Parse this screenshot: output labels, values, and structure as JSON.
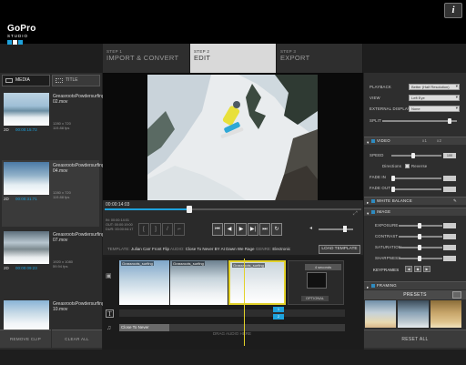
{
  "app": {
    "logo_word": "GoPro",
    "logo_sub": "STUDIO",
    "info_label": "i"
  },
  "steps": [
    {
      "step": "STEP 1",
      "label": "IMPORT & CONVERT"
    },
    {
      "step": "STEP 2",
      "label": "EDIT"
    },
    {
      "step": "STEP 3",
      "label": "EXPORT"
    }
  ],
  "left_tabs": [
    {
      "label": "MEDIA"
    },
    {
      "label": "TITLE"
    }
  ],
  "clips": [
    {
      "name": "GreasrootsPowdersurfing 02.mov",
      "resolution": "1280 x 720",
      "fps": "119.88 fps",
      "flags": "2D",
      "time": "00:00:15:72"
    },
    {
      "name": "GreasrootsPowdersurfing 04.mov",
      "resolution": "1280 x 720",
      "fps": "119.88 fps",
      "flags": "2D",
      "time": "00:00:31:71"
    },
    {
      "name": "GreasrootsPowdersurfing 07.mov",
      "resolution": "1920 x 1080",
      "fps": "59.94 fps",
      "flags": "2D",
      "time": "00:00:09:23"
    },
    {
      "name": "GreasrootsPowdersurfing 10.mov",
      "resolution": "1280 x 720",
      "fps": "119.88 fps",
      "flags": "2D",
      "time": "00:00:39:76"
    }
  ],
  "left_buttons": {
    "remove": "REMOVE CLIP",
    "clear": "CLEAR ALL"
  },
  "playback": {
    "timecode": "00:00:14:03",
    "in_out": [
      "IN: 00:00:14:01",
      "OUT: 00:00:19:00",
      "DUR: 00:00:04:17"
    ]
  },
  "template": {
    "label": "TEMPLATE:",
    "name": "Julian Carr Front Flip",
    "audio_label": "AUDIO:",
    "audio": "Close To Never BY At Dawn We Rage",
    "genre_label": "GENRE:",
    "genre": "Electronic",
    "load_button": "LOAD TEMPLATE"
  },
  "timeline": {
    "clips": [
      {
        "label": "Grassroots_surfing"
      },
      {
        "label": "Grassroots_surfing"
      },
      {
        "label": "Grassroots_surfing"
      }
    ],
    "seconds": "4 seconds",
    "optional": "OPTIONAL",
    "audio_track": "Close To Never",
    "drag_hint": "DRAG AUDIO HERE",
    "markers": [
      "1",
      "2"
    ]
  },
  "right_panel": {
    "playback_label": "PLAYBACK",
    "playback_value": "Better (Half Resolution)",
    "view_label": "VIEW",
    "view_value": "Left Eye",
    "external_label": "EXTERNAL DISPLAY",
    "external_value": "None",
    "split_label": "SPLIT",
    "video_section": "VIDEO",
    "speed_label": "SPEED",
    "speed_value": "100",
    "speed_x1": "x1",
    "speed_x2": "x2",
    "directions_label": "Directions",
    "reverse_label": "Reverse",
    "fade_in_label": "FADE IN",
    "fade_out_label": "FADE OUT",
    "white_balance": "WHITE BALANCE",
    "image_section": "IMAGE",
    "exposure": "EXPOSURE",
    "contrast": "CONTRAST",
    "saturation": "SATURATION",
    "sharpness": "SHARPNESS",
    "keyframes": "KEYFRAMES",
    "framing": "FRAMING",
    "presets": "PRESETS",
    "reset_all": "RESET ALL"
  },
  "colors": {
    "accent": "#1ea2dc",
    "timeline_selection": "#e2d12a"
  }
}
